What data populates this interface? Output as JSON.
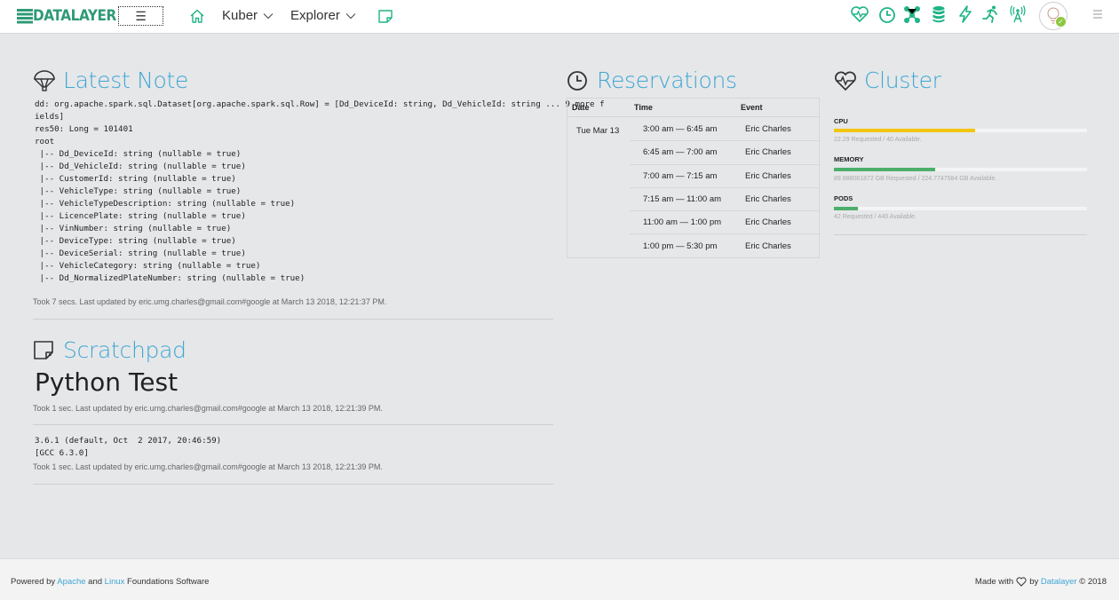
{
  "header": {
    "logo_text": "DATALAYER",
    "menu_glyph": "☰",
    "nav": [
      {
        "label": "Kuber"
      },
      {
        "label": "Explorer"
      }
    ],
    "right_icons": [
      "heart-pulse-icon",
      "clock-icon",
      "network-icon",
      "database-icon",
      "bolt-icon",
      "runner-icon",
      "antenna-icon"
    ],
    "accent": "#1fb487"
  },
  "latest_note": {
    "title": "Latest Note",
    "output": "dd: org.apache.spark.sql.Dataset[org.apache.spark.sql.Row] = [Dd_DeviceId: string, Dd_VehicleId: string ... 9 more f\nields]\nres50: Long = 101401\nroot\n |-- Dd_DeviceId: string (nullable = true)\n |-- Dd_VehicleId: string (nullable = true)\n |-- CustomerId: string (nullable = true)\n |-- VehicleType: string (nullable = true)\n |-- VehicleTypeDescription: string (nullable = true)\n |-- LicencePlate: string (nullable = true)\n |-- VinNumber: string (nullable = true)\n |-- DeviceType: string (nullable = true)\n |-- DeviceSerial: string (nullable = true)\n |-- VehicleCategory: string (nullable = true)\n |-- Dd_NormalizedPlateNumber: string (nullable = true)",
    "meta": "Took 7 secs. Last updated by eric.umg.charles@gmail.com#google at March 13 2018, 12:21:37 PM."
  },
  "scratchpad": {
    "title": "Scratchpad",
    "heading": "Python Test",
    "meta1": "Took 1 sec. Last updated by eric.umg.charles@gmail.com#google at March 13 2018, 12:21:39 PM.",
    "output": "3.6.1 (default, Oct  2 2017, 20:46:59)\n[GCC 6.3.0]",
    "meta2": "Took 1 sec. Last updated by eric.umg.charles@gmail.com#google at March 13 2018, 12:21:39 PM."
  },
  "reservations": {
    "title": "Reservations",
    "columns": [
      "Date",
      "Time",
      "Event"
    ],
    "date": "Tue Mar 13",
    "rows": [
      {
        "time": "3:00 am — 6:45 am",
        "event": "Eric Charles"
      },
      {
        "time": "6:45 am — 7:00 am",
        "event": "Eric Charles"
      },
      {
        "time": "7:00 am — 7:15 am",
        "event": "Eric Charles"
      },
      {
        "time": "7:15 am — 11:00 am",
        "event": "Eric Charles"
      },
      {
        "time": "11:00 am — 1:00 pm",
        "event": "Eric Charles"
      },
      {
        "time": "1:00 pm — 5:30 pm",
        "event": "Eric Charles"
      }
    ]
  },
  "cluster": {
    "title": "Cluster",
    "metrics": [
      {
        "label": "CPU",
        "detail": "22.29 Requested / 40 Available.",
        "fraction": 0.557,
        "color": "#f2c511"
      },
      {
        "label": "MEMORY",
        "detail": "89.888081872 GB Requested / 224.7747584 GB Available.",
        "fraction": 0.4,
        "color": "#4caf6a"
      },
      {
        "label": "PODS",
        "detail": "42 Requested / 440 Available.",
        "fraction": 0.095,
        "color": "#4caf6a"
      }
    ]
  },
  "footer": {
    "powered_by": "Powered by",
    "apache": "Apache",
    "and": "and",
    "linux": "Linux",
    "software": "Foundations Software",
    "made_with": "Made with",
    "by": "by",
    "datalayer": "Datalayer",
    "copyright": "© 2018"
  }
}
